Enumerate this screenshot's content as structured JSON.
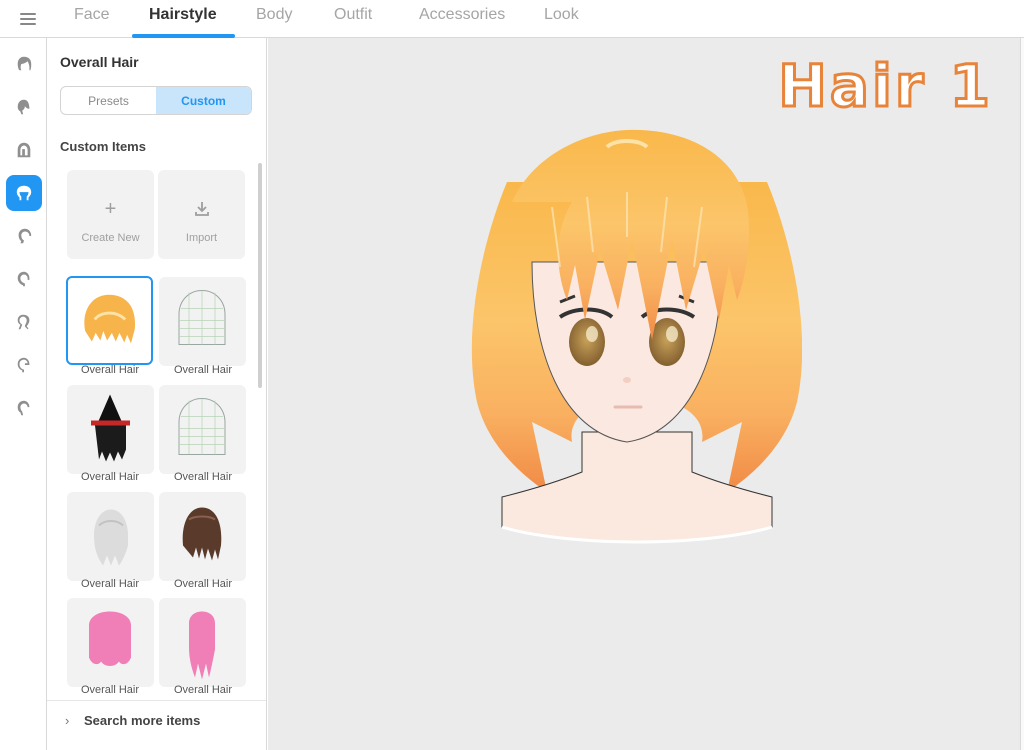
{
  "nav": {
    "tabs": [
      {
        "label": "Face"
      },
      {
        "label": "Hairstyle"
      },
      {
        "label": "Body"
      },
      {
        "label": "Outfit"
      },
      {
        "label": "Accessories"
      },
      {
        "label": "Look"
      }
    ],
    "active_tab": "Hairstyle"
  },
  "rail": {
    "items": [
      "overall-hair-icon",
      "front-hair-icon",
      "back-hair-icon",
      "side-hair-icon",
      "ahoge-icon",
      "hair-extension-icon",
      "tail-icon",
      "hair-accessory-icon",
      "base-hair-icon"
    ],
    "active_index": 3
  },
  "panel": {
    "title": "Overall Hair",
    "segment": {
      "presets": "Presets",
      "custom": "Custom",
      "active": "Custom"
    },
    "section_title": "Custom Items",
    "create_new": "Create New",
    "import": "Import",
    "items": [
      {
        "label": "Overall Hair",
        "thumb": "orange-hair",
        "selected": true
      },
      {
        "label": "Overall Hair",
        "thumb": "wireframe"
      },
      {
        "label": "Overall Hair",
        "thumb": "black-hat-hair"
      },
      {
        "label": "Overall Hair",
        "thumb": "wireframe"
      },
      {
        "label": "Overall Hair",
        "thumb": "white-braided-hair"
      },
      {
        "label": "Overall Hair",
        "thumb": "brown-hair"
      },
      {
        "label": "Overall Hair",
        "thumb": "pink-hair"
      },
      {
        "label": "Overall Hair",
        "thumb": "pink-long-hair"
      }
    ],
    "search_more": "Search more items"
  },
  "viewport": {
    "overlay_title": "Hair 1"
  },
  "colors": {
    "accent": "#2196f3",
    "accent_light": "#c8e5fb",
    "overlay_stroke": "#e8833a",
    "hair": "#f7b44a"
  }
}
